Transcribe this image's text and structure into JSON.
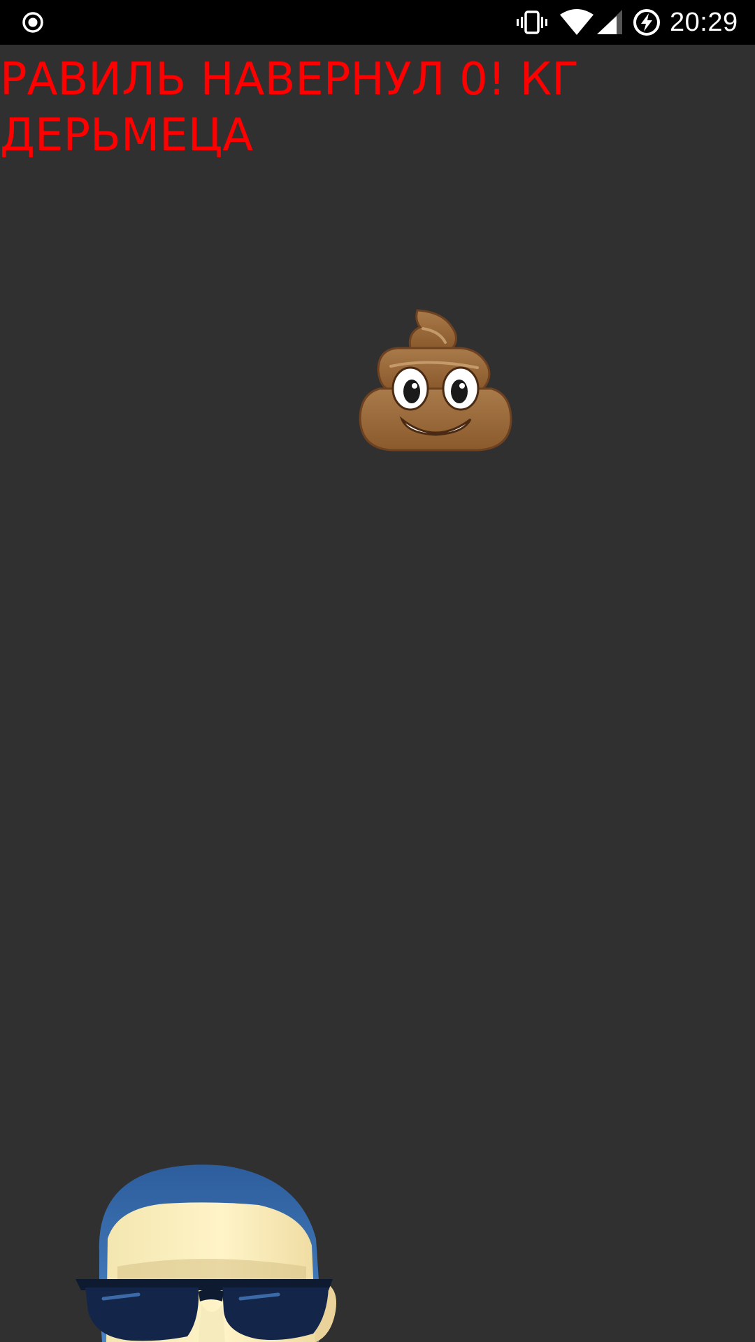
{
  "status_bar": {
    "time": "20:29",
    "icons": [
      "record-icon",
      "vibrate-icon",
      "wifi-icon",
      "cell-signal-icon",
      "battery-charging-icon"
    ]
  },
  "game": {
    "score_prefix": "РАВИЛЬ НАВЕРНУЛ",
    "score_value": "0!",
    "score_suffix": "КГ ДЕРЬМЕЦА",
    "falling_item": "pile-of-poo",
    "player": "player-face-with-sunglasses"
  },
  "colors": {
    "background": "#303030",
    "status_bar": "#000000",
    "score_text": "#ff0000"
  }
}
